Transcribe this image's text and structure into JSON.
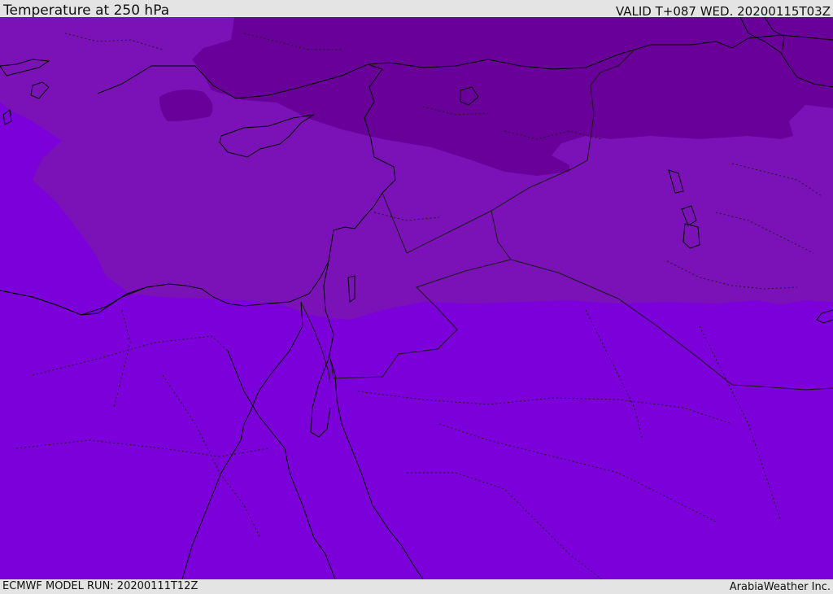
{
  "header": {
    "title": "Temperature at 250 hPa",
    "valid": "VALID T+087 WED. 20200115T03Z"
  },
  "footer": {
    "model_run": "ECMWF MODEL RUN: 20200111T12Z",
    "credit": "ArabiaWeather Inc."
  },
  "map": {
    "colors": {
      "coldest": "#69009a",
      "cold": "#7a12b8",
      "base": "#7c00d9",
      "coastline": "#000000",
      "border": "#1a1a1a"
    }
  }
}
